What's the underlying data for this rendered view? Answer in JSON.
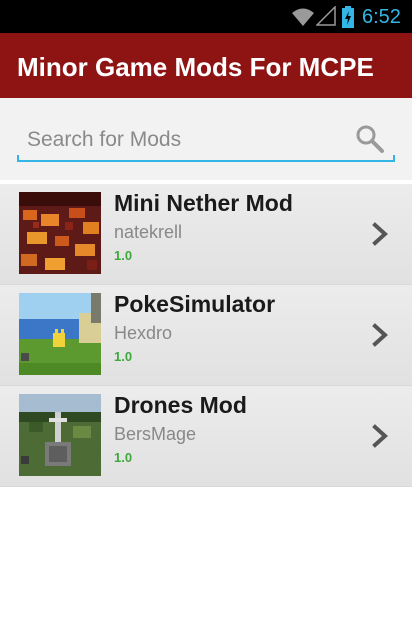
{
  "status_bar": {
    "time": "6:52",
    "wifi_icon": "wifi-icon",
    "signal_icon": "cell-signal-icon",
    "battery_icon": "battery-charging-icon",
    "accent_color": "#33b5e5"
  },
  "app_bar": {
    "title": "Minor Game Mods For MCPE",
    "background_color": "#8e1414"
  },
  "search": {
    "placeholder": "Search for Mods",
    "value": "",
    "icon": "search-icon"
  },
  "mods": [
    {
      "name": "Mini Nether Mod",
      "author": "natekrell",
      "version": "1.0",
      "thumbnail": "nether-thumbnail"
    },
    {
      "name": "PokeSimulator",
      "author": "Hexdro",
      "version": "1.0",
      "thumbnail": "pokemon-thumbnail"
    },
    {
      "name": "Drones Mod",
      "author": "BersMage",
      "version": "1.0",
      "thumbnail": "drone-thumbnail"
    }
  ],
  "version_color": "#3ea83a"
}
